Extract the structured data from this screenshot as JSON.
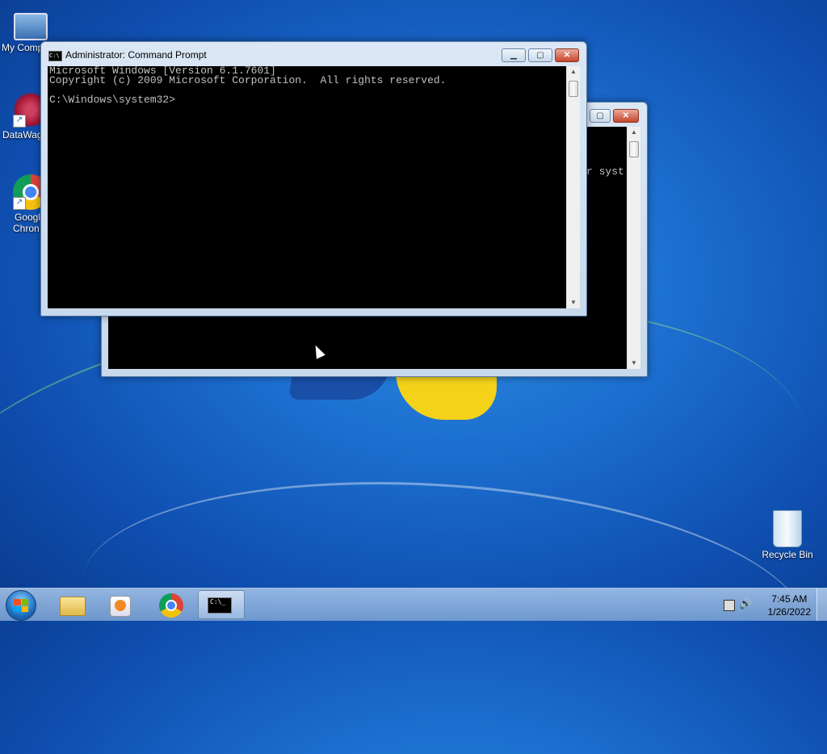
{
  "desktop": {
    "icons": [
      {
        "label": "My Comp",
        "kind": "computer"
      },
      {
        "label": "DataWag",
        "kind": "datawagon"
      },
      {
        "label": "Googl Chron",
        "line1": "Googl",
        "line2": "Chron",
        "kind": "chrome"
      },
      {
        "label": "Recycle Bin",
        "kind": "recycle-bin"
      }
    ]
  },
  "front_window": {
    "title": "Administrator: Command Prompt",
    "lines": [
      "Microsoft Windows [Version 6.1.7601]",
      "Copyright (c) 2009 Microsoft Corporation.  All rights reserved.",
      "",
      "C:\\Windows\\system32>"
    ],
    "buttons": {
      "minimize": "▁",
      "maximize": "▢",
      "close": "✕"
    }
  },
  "back_window": {
    "visible_text": "r syst",
    "buttons": {
      "maximize": "▢",
      "close": "✕"
    }
  },
  "taskbar": {
    "pinned": [
      "windows-explorer",
      "media-player",
      "google-chrome",
      "command-prompt"
    ],
    "cmd_icon_text": "C:\\_",
    "clock_time": "7:45 AM",
    "clock_date": "1/26/2022"
  },
  "colors": {
    "console_bg": "#000000",
    "console_fg": "#c0c0c0",
    "accent": "#1c6fd0"
  }
}
